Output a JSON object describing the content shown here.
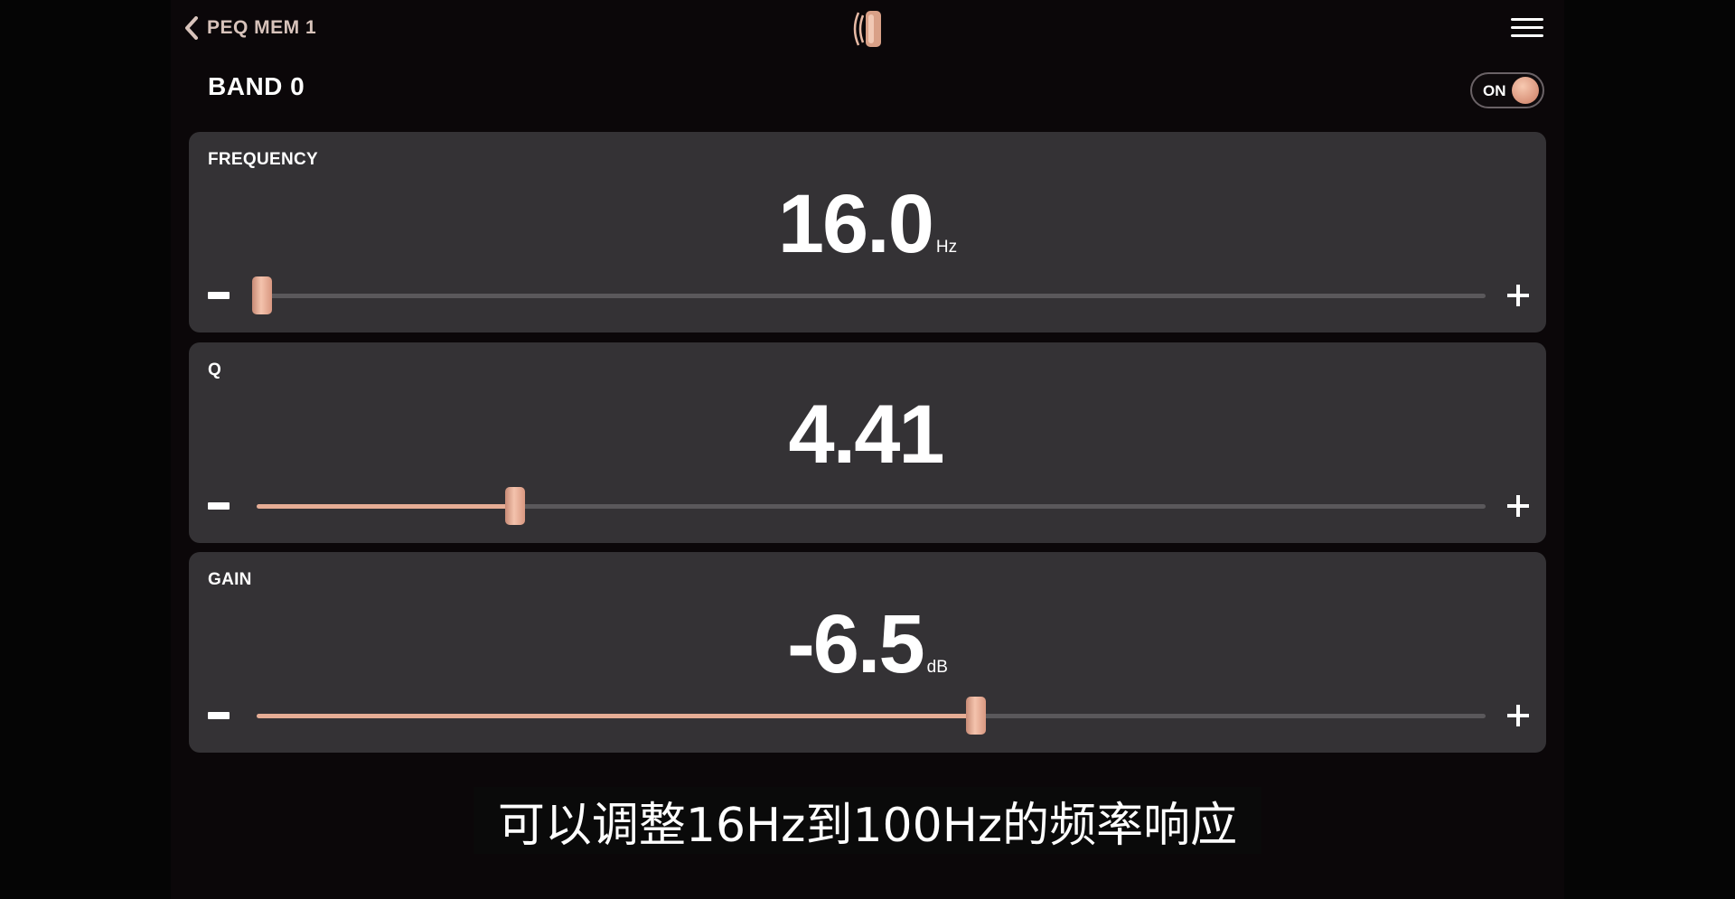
{
  "header": {
    "back_label": "PEQ MEM 1",
    "band_title": "BAND 0",
    "toggle_label": "ON",
    "logo_icon": "speaker-logo-icon",
    "menu_icon": "hamburger-menu-icon"
  },
  "panels": [
    {
      "label": "FREQUENCY",
      "value": "16.0",
      "unit": "Hz",
      "slider_fraction": 0.0
    },
    {
      "label": "Q",
      "value": "4.41",
      "unit": "",
      "slider_fraction": 0.21
    },
    {
      "label": "GAIN",
      "value": "-6.5",
      "unit": "dB",
      "slider_fraction": 0.585
    }
  ],
  "subtitle": "可以调整16Hz到100Hz的频率响应",
  "colors": {
    "accent": "#e6ad95",
    "panel": "#343235",
    "background": "#0b0709"
  }
}
